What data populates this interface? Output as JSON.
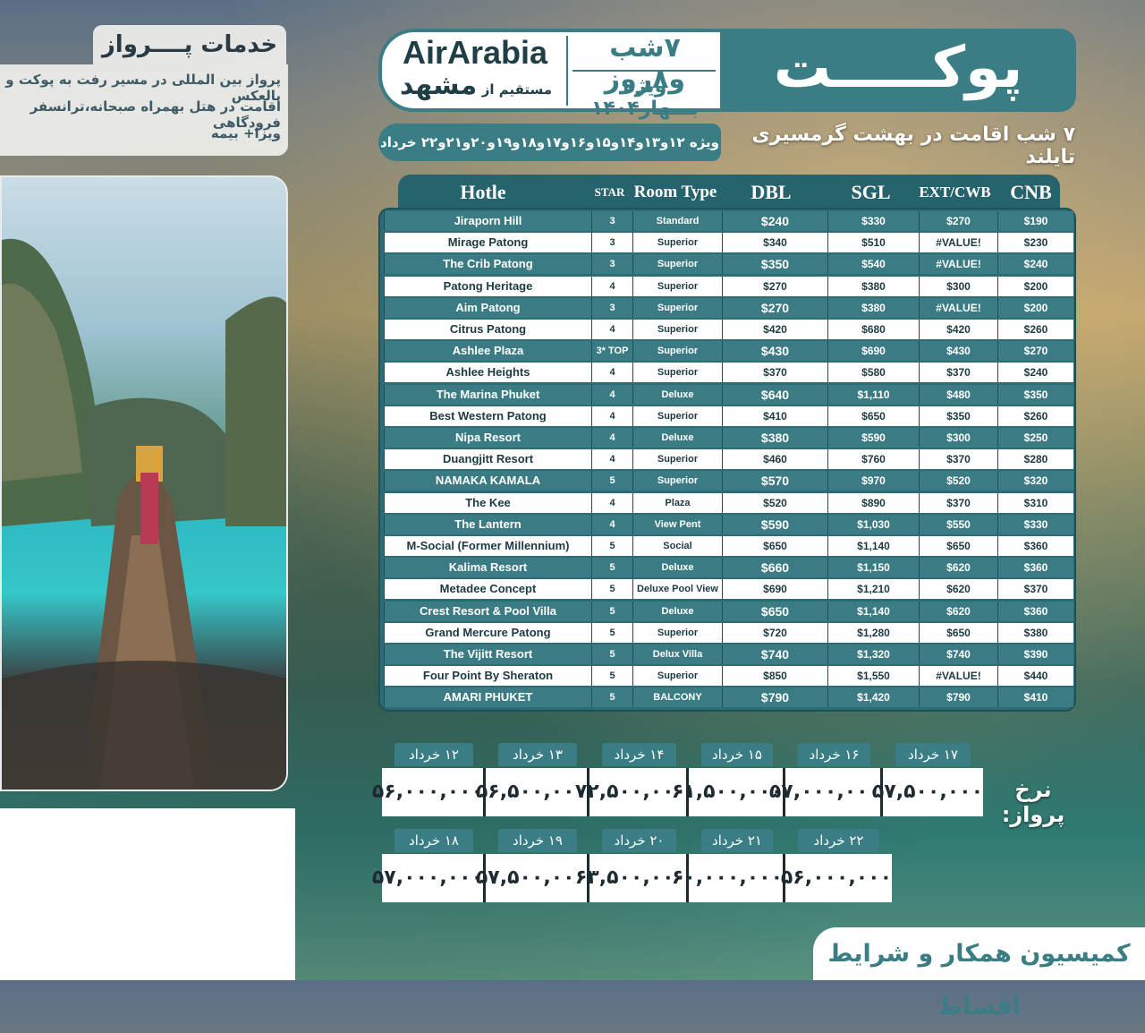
{
  "services": {
    "title": "خدمات پــــرواز",
    "lines": [
      "پرواز بین المللی در مسیر رفت به پوکت و بالعکس",
      "اقامت در هتل بهمراه صبحانه،ترانسفر فرودگاهی",
      "ویزا+ بیمه"
    ]
  },
  "header": {
    "airline": "AirArabia",
    "origin_prefix": "مستقیم از",
    "origin_city": "مشهد",
    "nights": "۷شب و۸روز",
    "season": "ویژه بـــهار۱۴۰۴",
    "destination": "پوکـــــت"
  },
  "subtitle": "۷ شب اقامت در بهشت گرمسیری تایلند",
  "dates_note": "ویژه ۱۲و۱۳و۱۴و۱۵و۱۶و۱۷و۱۸و۱۹و۲۰و۲۱و۲۲ خرداد",
  "table": {
    "headers": {
      "hotel": "Hotle",
      "star": "STAR",
      "room": "Room Type",
      "dbl": "DBL",
      "sgl": "SGL",
      "ext": "EXT/CWB",
      "cnb": "CNB"
    },
    "rows": [
      {
        "hotel": "Jiraporn Hill",
        "star": "3",
        "room": "Standard",
        "dbl": "$240",
        "sgl": "$330",
        "ext": "$270",
        "cnb": "$190"
      },
      {
        "hotel": "Mirage Patong",
        "star": "3",
        "room": "Superior",
        "dbl": "$340",
        "sgl": "$510",
        "ext": "#VALUE!",
        "cnb": "$230"
      },
      {
        "hotel": "The Crib Patong",
        "star": "3",
        "room": "Superior",
        "dbl": "$350",
        "sgl": "$540",
        "ext": "#VALUE!",
        "cnb": "$240"
      },
      {
        "hotel": "Patong Heritage",
        "star": "4",
        "room": "Superior",
        "dbl": "$270",
        "sgl": "$380",
        "ext": "$300",
        "cnb": "$200"
      },
      {
        "hotel": "Aim Patong",
        "star": "3",
        "room": "Superior",
        "dbl": "$270",
        "sgl": "$380",
        "ext": "#VALUE!",
        "cnb": "$200"
      },
      {
        "hotel": "Citrus Patong",
        "star": "4",
        "room": "Superior",
        "dbl": "$420",
        "sgl": "$680",
        "ext": "$420",
        "cnb": "$260"
      },
      {
        "hotel": "Ashlee Plaza",
        "star": "3* TOP",
        "room": "Superior",
        "dbl": "$430",
        "sgl": "$690",
        "ext": "$430",
        "cnb": "$270"
      },
      {
        "hotel": "Ashlee Heights",
        "star": "4",
        "room": "Superior",
        "dbl": "$370",
        "sgl": "$580",
        "ext": "$370",
        "cnb": "$240"
      },
      {
        "hotel": "The Marina Phuket",
        "star": "4",
        "room": "Deluxe",
        "dbl": "$640",
        "sgl": "$1,110",
        "ext": "$480",
        "cnb": "$350"
      },
      {
        "hotel": "Best Western Patong",
        "star": "4",
        "room": "Superior",
        "dbl": "$410",
        "sgl": "$650",
        "ext": "$350",
        "cnb": "$260"
      },
      {
        "hotel": "Nipa Resort",
        "star": "4",
        "room": "Deluxe",
        "dbl": "$380",
        "sgl": "$590",
        "ext": "$300",
        "cnb": "$250"
      },
      {
        "hotel": "Duangjitt Resort",
        "star": "4",
        "room": "Superior",
        "dbl": "$460",
        "sgl": "$760",
        "ext": "$370",
        "cnb": "$280"
      },
      {
        "hotel": "NAMAKA KAMALA",
        "star": "5",
        "room": "Superior",
        "dbl": "$570",
        "sgl": "$970",
        "ext": "$520",
        "cnb": "$320"
      },
      {
        "hotel": "The Kee",
        "star": "4",
        "room": "Plaza",
        "dbl": "$520",
        "sgl": "$890",
        "ext": "$370",
        "cnb": "$310"
      },
      {
        "hotel": "The Lantern",
        "star": "4",
        "room": "View Pent",
        "dbl": "$590",
        "sgl": "$1,030",
        "ext": "$550",
        "cnb": "$330"
      },
      {
        "hotel": "M-Social (Former Millennium)",
        "star": "5",
        "room": "Social",
        "dbl": "$650",
        "sgl": "$1,140",
        "ext": "$650",
        "cnb": "$360"
      },
      {
        "hotel": "Kalima Resort",
        "star": "5",
        "room": "Deluxe",
        "dbl": "$660",
        "sgl": "$1,150",
        "ext": "$620",
        "cnb": "$360"
      },
      {
        "hotel": "Metadee Concept",
        "star": "5",
        "room": "Deluxe Pool View",
        "dbl": "$690",
        "sgl": "$1,210",
        "ext": "$620",
        "cnb": "$370"
      },
      {
        "hotel": "Crest Resort & Pool Villa",
        "star": "5",
        "room": "Deluxe",
        "dbl": "$650",
        "sgl": "$1,140",
        "ext": "$620",
        "cnb": "$360"
      },
      {
        "hotel": "Grand Mercure Patong",
        "star": "5",
        "room": "Superior",
        "dbl": "$720",
        "sgl": "$1,280",
        "ext": "$650",
        "cnb": "$380"
      },
      {
        "hotel": "The Vijitt Resort",
        "star": "5",
        "room": "Delux Villa",
        "dbl": "$740",
        "sgl": "$1,320",
        "ext": "$740",
        "cnb": "$390"
      },
      {
        "hotel": "Four Point By Sheraton",
        "star": "5",
        "room": "Superior",
        "dbl": "$850",
        "sgl": "$1,550",
        "ext": "#VALUE!",
        "cnb": "$440"
      },
      {
        "hotel": "AMARI PHUKET",
        "star": "5",
        "room": "BALCONY",
        "dbl": "$790",
        "sgl": "$1,420",
        "ext": "$790",
        "cnb": "$410"
      }
    ]
  },
  "fares": {
    "label": "نرخ پرواز:",
    "row1": [
      {
        "date": "۱۲ خرداد",
        "price": "۵۶,۰۰۰,۰۰۰"
      },
      {
        "date": "۱۳ خرداد",
        "price": "۵۶,۵۰۰,۰۰۰"
      },
      {
        "date": "۱۴ خرداد",
        "price": "۷۲,۵۰۰,۰۰۰"
      },
      {
        "date": "۱۵ خرداد",
        "price": "۶۱,۵۰۰,۰۰۰"
      },
      {
        "date": "۱۶ خرداد",
        "price": "۵۷,۰۰۰,۰۰۰"
      },
      {
        "date": "۱۷ خرداد",
        "price": "۵۷,۵۰۰,۰۰۰"
      }
    ],
    "row2": [
      {
        "date": "۱۸ خرداد",
        "price": "۵۷,۰۰۰,۰۰۰"
      },
      {
        "date": "۱۹ خرداد",
        "price": "۵۷,۵۰۰,۰۰۰"
      },
      {
        "date": "۲۰ خرداد",
        "price": "۶۳,۵۰۰,۰۰۰"
      },
      {
        "date": "۲۱ خرداد",
        "price": "۶۰,۰۰۰,۰۰۰"
      },
      {
        "date": "۲۲ خرداد",
        "price": "۵۶,۰۰۰,۰۰۰"
      }
    ]
  },
  "commission": "کمیسیون همکار و شرایط اقساط",
  "colors": {
    "teal": "#3a7d85",
    "dark_teal": "#27636c",
    "white": "#ffffff"
  }
}
